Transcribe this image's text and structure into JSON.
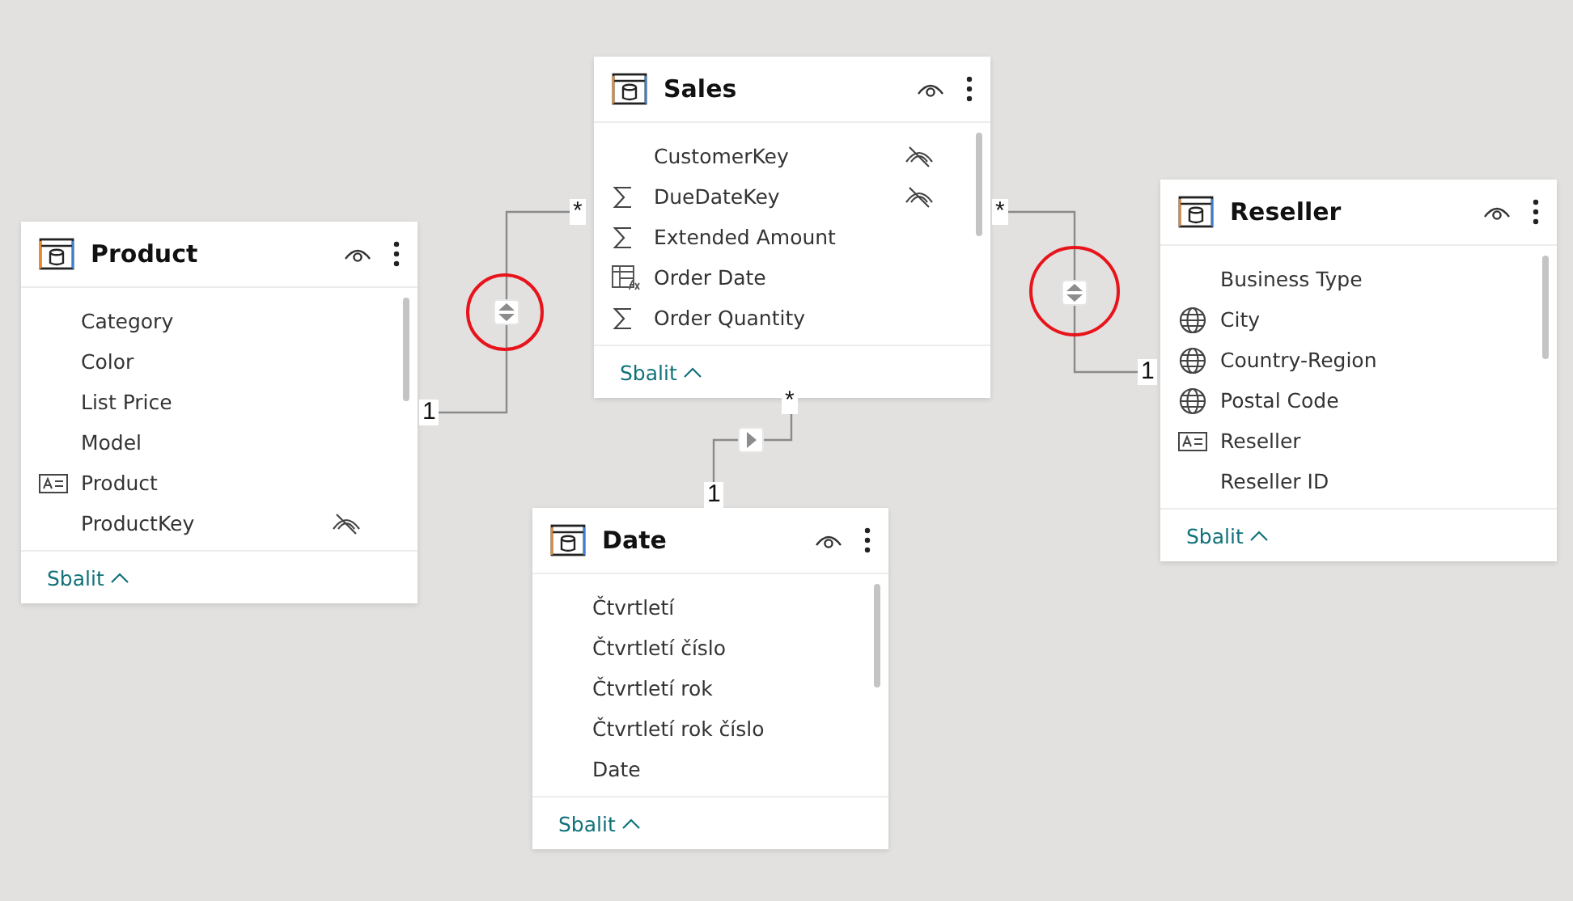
{
  "tables": [
    {
      "name": "Product",
      "visible": true,
      "fields": [
        {
          "name": "Category",
          "kind": "plain",
          "hidden": false
        },
        {
          "name": "Color",
          "kind": "plain",
          "hidden": false
        },
        {
          "name": "List Price",
          "kind": "plain",
          "hidden": false
        },
        {
          "name": "Model",
          "kind": "plain",
          "hidden": false
        },
        {
          "name": "Product",
          "kind": "card",
          "hidden": false
        },
        {
          "name": "ProductKey",
          "kind": "plain",
          "hidden": true
        }
      ],
      "footer": "Sbalit"
    },
    {
      "name": "Sales",
      "visible": true,
      "fields": [
        {
          "name": "CustomerKey",
          "kind": "plain",
          "hidden": true
        },
        {
          "name": "DueDateKey",
          "kind": "sigma",
          "hidden": true
        },
        {
          "name": "Extended Amount",
          "kind": "sigma",
          "hidden": false
        },
        {
          "name": "Order Date",
          "kind": "calc",
          "hidden": false
        },
        {
          "name": "Order Quantity",
          "kind": "sigma",
          "hidden": false
        }
      ],
      "footer": "Sbalit"
    },
    {
      "name": "Reseller",
      "visible": true,
      "fields": [
        {
          "name": "Business Type",
          "kind": "plain",
          "hidden": false
        },
        {
          "name": "City",
          "kind": "globe",
          "hidden": false
        },
        {
          "name": "Country-Region",
          "kind": "globe",
          "hidden": false
        },
        {
          "name": "Postal Code",
          "kind": "globe",
          "hidden": false
        },
        {
          "name": "Reseller",
          "kind": "card",
          "hidden": false
        },
        {
          "name": "Reseller ID",
          "kind": "plain",
          "hidden": false
        }
      ],
      "footer": "Sbalit"
    },
    {
      "name": "Date",
      "visible": true,
      "fields": [
        {
          "name": "Čtvrtletí",
          "kind": "plain",
          "hidden": false
        },
        {
          "name": "Čtvrtletí číslo",
          "kind": "plain",
          "hidden": false
        },
        {
          "name": "Čtvrtletí rok",
          "kind": "plain",
          "hidden": false
        },
        {
          "name": "Čtvrtletí rok číslo",
          "kind": "plain",
          "hidden": false
        },
        {
          "name": "Date",
          "kind": "plain",
          "hidden": false
        }
      ],
      "footer": "Sbalit"
    }
  ],
  "relationships": [
    {
      "many_label": "*",
      "one_label": "1",
      "kind": "both",
      "circled": true
    },
    {
      "many_label": "*",
      "one_label": "1",
      "kind": "both",
      "circled": true
    },
    {
      "many_label": "*",
      "one_label": "1",
      "kind": "single",
      "circled": false
    }
  ]
}
